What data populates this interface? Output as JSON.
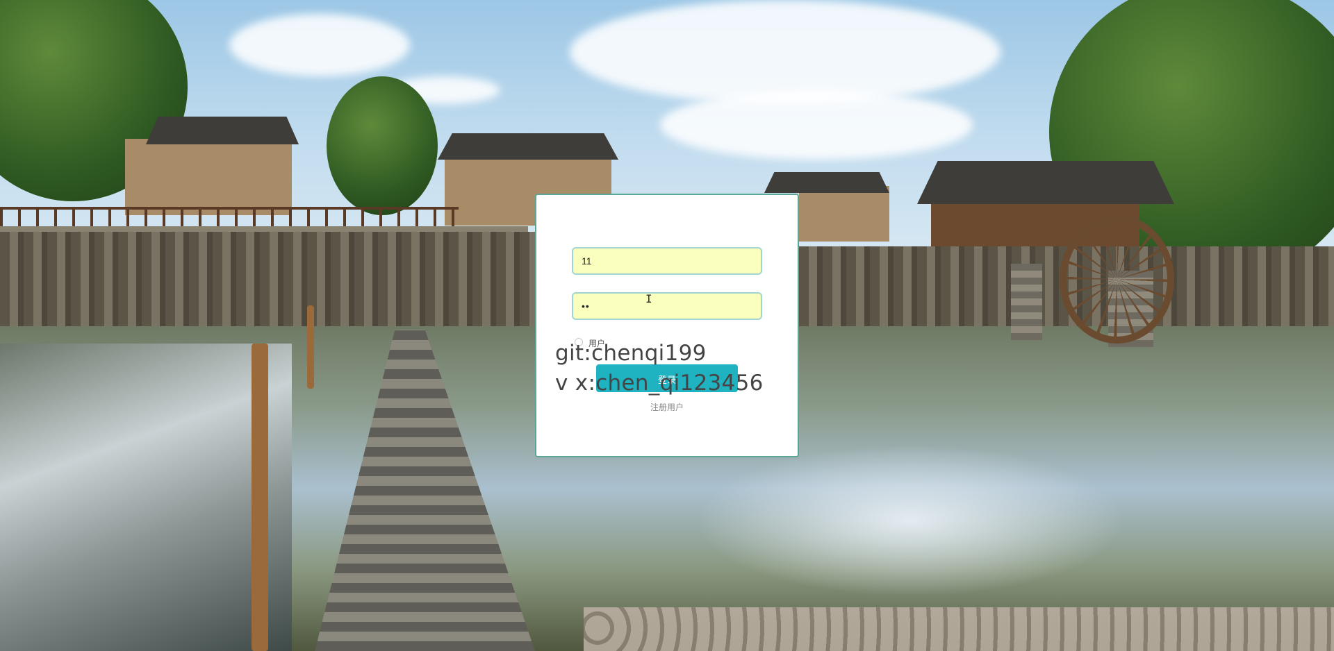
{
  "login": {
    "username_value": "11",
    "password_value": "••",
    "role_label": "用户",
    "login_button_label": "登录",
    "register_link_label": "注册用户"
  },
  "overlay": {
    "git_line": "git:chenqi199",
    "wechat_line": "v x:chen_qi123456"
  },
  "cursor_glyph": "I",
  "colors": {
    "card_border": "#5aa596",
    "input_background": "#faffbd",
    "button_background": "#1fb2c1"
  }
}
